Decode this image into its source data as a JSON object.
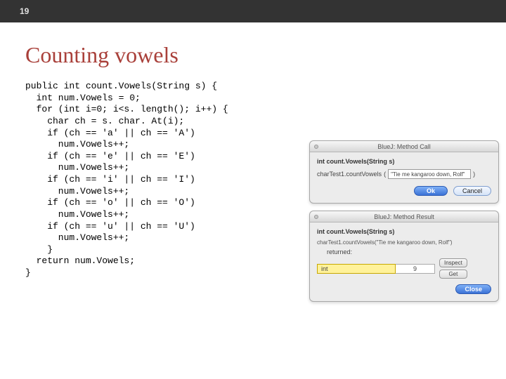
{
  "page_number": "19",
  "title": "Counting vowels",
  "code": "public int count.Vowels(String s) {\n  int num.Vowels = 0;\n  for (int i=0; i<s. length(); i++) {\n    char ch = s. char. At(i);\n    if (ch == 'a' || ch == 'A')\n      num.Vowels++;\n    if (ch == 'e' || ch == 'E')\n      num.Vowels++;\n    if (ch == 'i' || ch == 'I')\n      num.Vowels++;\n    if (ch == 'o' || ch == 'O')\n      num.Vowels++;\n    if (ch == 'u' || ch == 'U')\n      num.Vowels++;\n    }\n  return num.Vowels;\n}",
  "dialog_call": {
    "title": "BlueJ:  Method Call",
    "signature": "int count.Vowels(String s)",
    "invocation_prefix": "charTest1.countVowels",
    "open_paren": "(",
    "close_paren": ")",
    "arg_value": "\"Tie me kangaroo down, Rolf\"",
    "ok": "Ok",
    "cancel": "Cancel"
  },
  "dialog_result": {
    "title": "BlueJ:  Method Result",
    "signature": "int count.Vowels(String s)",
    "call_line": "charTest1.countVowels(\"Tie me kangaroo down, Rolf\")",
    "returned_label": "returned:",
    "result_type": "int",
    "result_value": "9",
    "inspect": "Inspect",
    "get": "Get",
    "close": "Close"
  }
}
